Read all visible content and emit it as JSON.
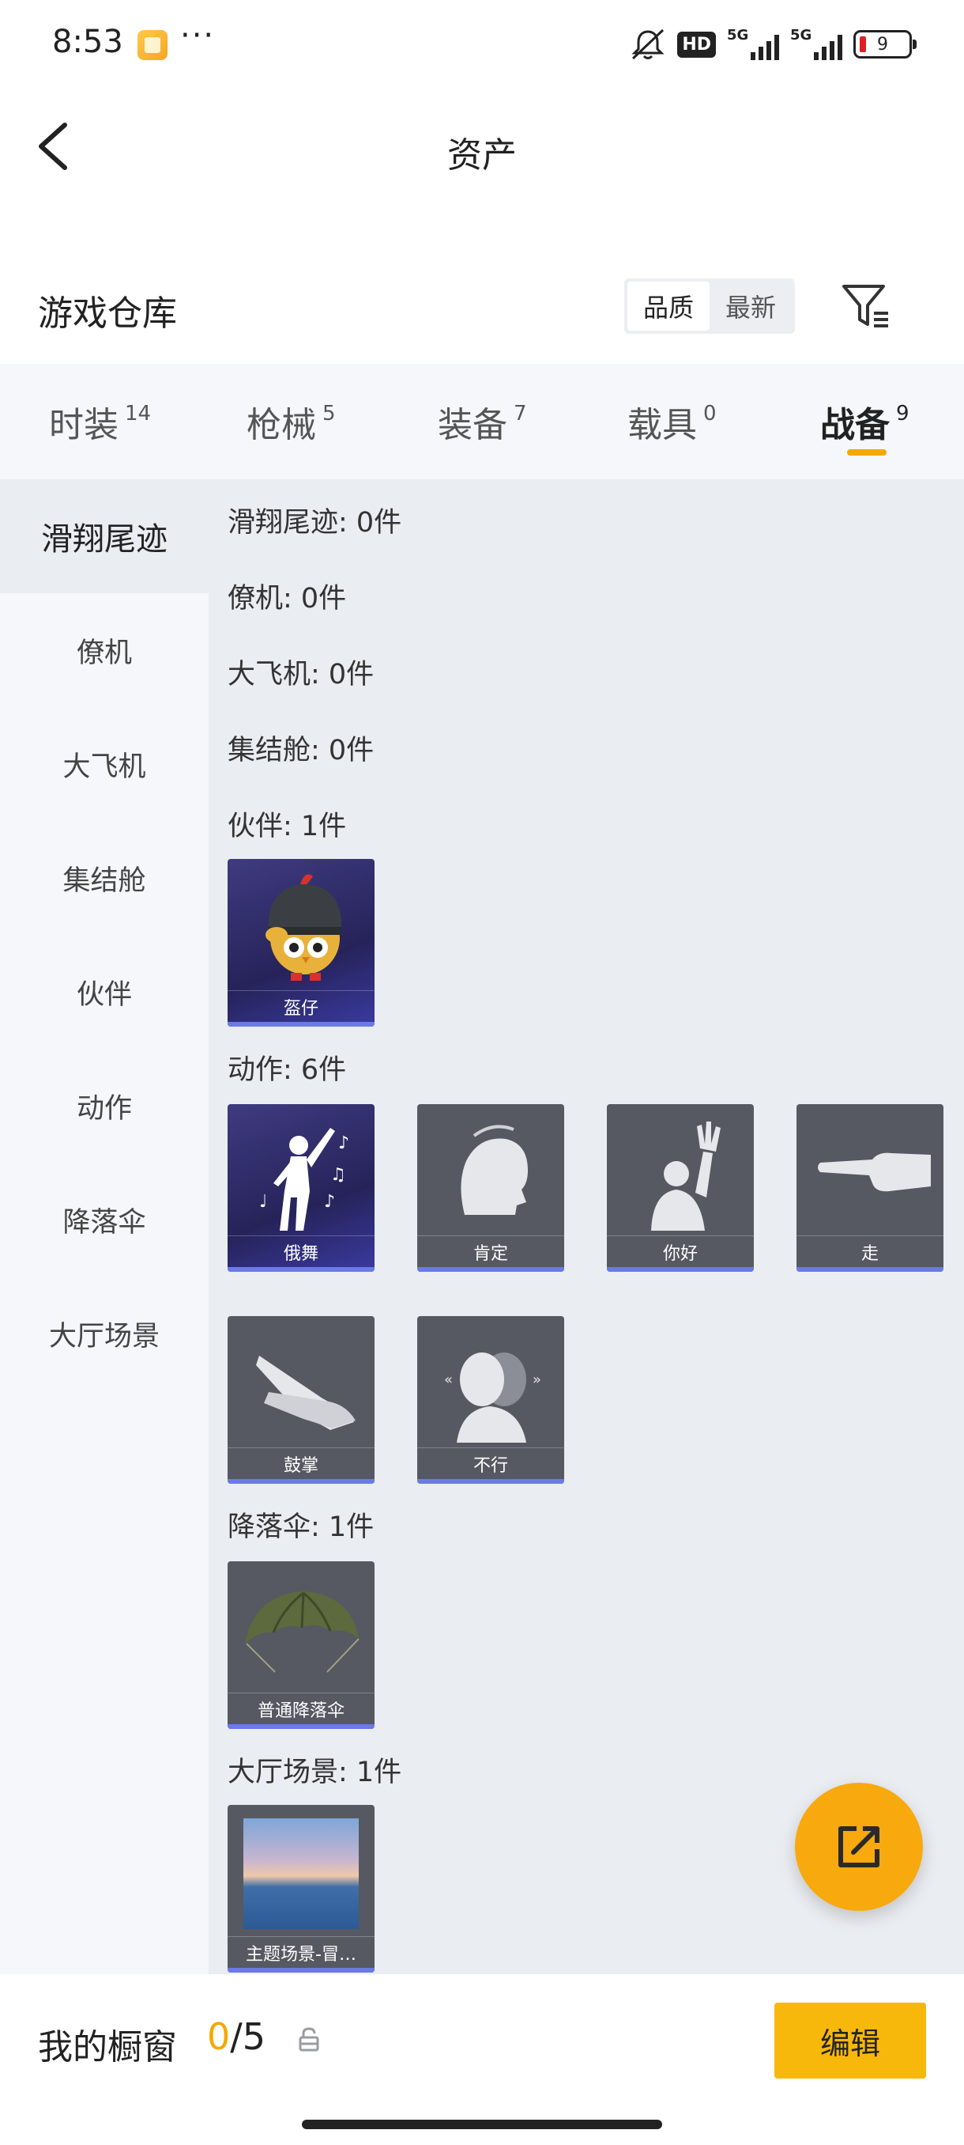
{
  "status_bar": {
    "time": "8:53",
    "more": "···",
    "hd_label": "HD",
    "net1": "5G",
    "net2": "5G",
    "battery": "9",
    "icons": [
      "app-notification-icon",
      "mute-icon",
      "signal-icon",
      "battery-icon"
    ]
  },
  "header": {
    "title": "资产",
    "back_icon": "chevron-left-icon"
  },
  "section": {
    "title": "游戏仓库",
    "sort_options": [
      "品质",
      "最新"
    ],
    "sort_selected": "品质",
    "filter_icon": "filter-icon"
  },
  "tabs": [
    {
      "label": "时装",
      "count": "14"
    },
    {
      "label": "枪械",
      "count": "5"
    },
    {
      "label": "装备",
      "count": "7"
    },
    {
      "label": "载具",
      "count": "0"
    },
    {
      "label": "战备",
      "count": "9",
      "active": true
    }
  ],
  "sidebar": {
    "items": [
      "滑翔尾迹",
      "僚机",
      "大飞机",
      "集结舱",
      "伙伴",
      "动作",
      "降落伞",
      "大厅场景"
    ],
    "active": "滑翔尾迹"
  },
  "content": {
    "categories": [
      {
        "label": "滑翔尾迹: 0件"
      },
      {
        "label": "僚机: 0件"
      },
      {
        "label": "大飞机: 0件"
      },
      {
        "label": "集结舱: 0件"
      },
      {
        "label": "伙伴: 1件"
      },
      {
        "label": "动作: 6件"
      },
      {
        "label": "降落伞: 1件"
      },
      {
        "label": "大厅场景: 1件"
      }
    ],
    "items": {
      "companion": [
        {
          "name": "盔仔"
        }
      ],
      "actions": [
        {
          "name": "俄舞"
        },
        {
          "name": "肯定"
        },
        {
          "name": "你好"
        },
        {
          "name": "走"
        },
        {
          "name": "鼓掌"
        },
        {
          "name": "不行"
        }
      ],
      "parachute": [
        {
          "name": "普通降落伞"
        }
      ],
      "lobby": [
        {
          "name": "主题场景-冒…"
        }
      ]
    }
  },
  "fab": {
    "icon": "share-icon"
  },
  "bottom": {
    "label": "我的橱窗",
    "current": "0",
    "total": "/5",
    "lock_icon": "lock-icon",
    "edit_label": "编辑"
  },
  "colors": {
    "accent": "#f5a800",
    "rarity_bar": "#6b7ae8"
  }
}
